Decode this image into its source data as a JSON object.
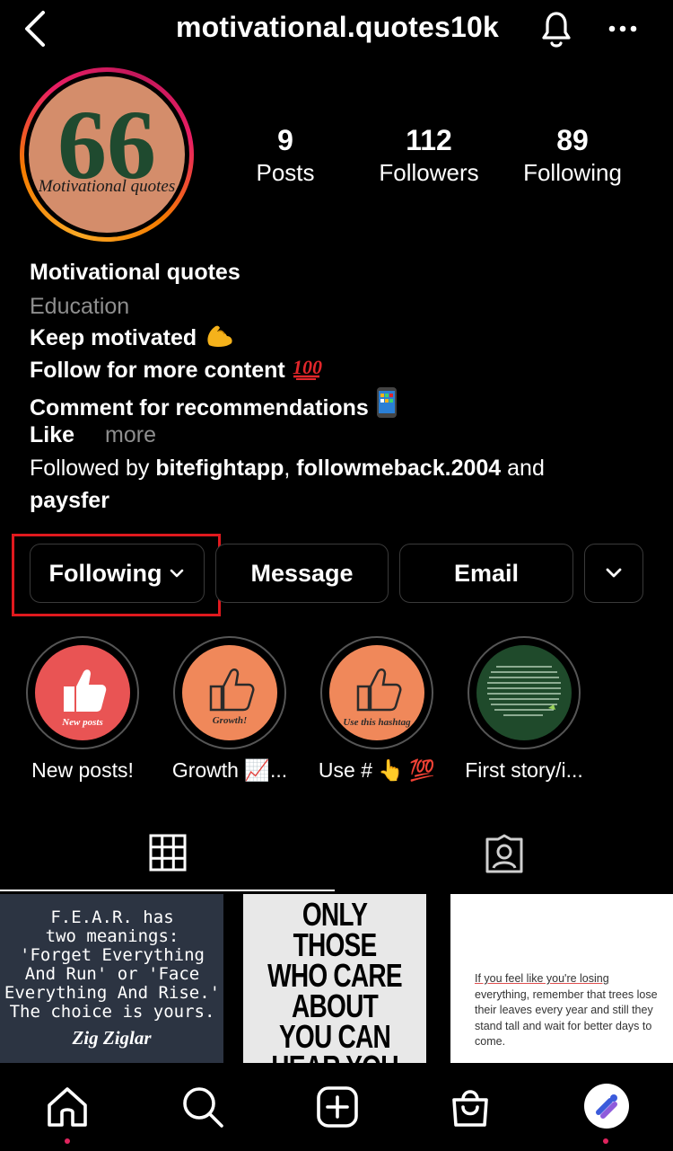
{
  "header": {
    "username": "motivational.quotes10k"
  },
  "avatar": {
    "quote_mark": "66",
    "text": "Motivational quotes"
  },
  "stats": [
    {
      "value": "9",
      "label": "Posts"
    },
    {
      "value": "112",
      "label": "Followers"
    },
    {
      "value": "89",
      "label": "Following"
    }
  ],
  "bio": {
    "name": "Motivational quotes",
    "category": "Education",
    "lines": [
      "Keep motivated",
      "Follow for more content",
      "Comment for recommendations",
      "Like"
    ],
    "more": "more",
    "followed_prefix": "Followed by ",
    "followed_user1": "bitefightapp",
    "followed_sep": ", ",
    "followed_user2": "followmeback.2004",
    "followed_and": " and",
    "followed_user3": "paysfer"
  },
  "buttons": {
    "following": "Following",
    "message": "Message",
    "email": "Email"
  },
  "highlights": [
    {
      "label": "New posts!",
      "caption": "New posts",
      "color": "#e95454"
    },
    {
      "label": "Growth 📈...",
      "caption": "Growth!",
      "color": "#f0885a"
    },
    {
      "label": "Use # 👆 💯",
      "caption": "Use this hashtag",
      "color": "#f0885a"
    },
    {
      "label": "First story/i...",
      "caption": "",
      "color": "#1f4a2b"
    }
  ],
  "posts": {
    "p1_text": "F.E.A.R. has\ntwo meanings:\n'Forget Everything\nAnd Run' or 'Face\nEverything And Rise.'\nThe choice is yours.",
    "p1_author": "Zig Ziglar",
    "p2_text": "ONLY THOSE WHO CARE ABOUT YOU CAN HEAR YOU WHEN YOU'RE",
    "p3_first": "If you feel like you're losing",
    "p3_rest": "everything, remember that trees lose their leaves every year and still they stand tall and wait for better days to come."
  },
  "colors": {
    "accent_red": "#e0191e",
    "notification_dot": "#e0245e"
  }
}
